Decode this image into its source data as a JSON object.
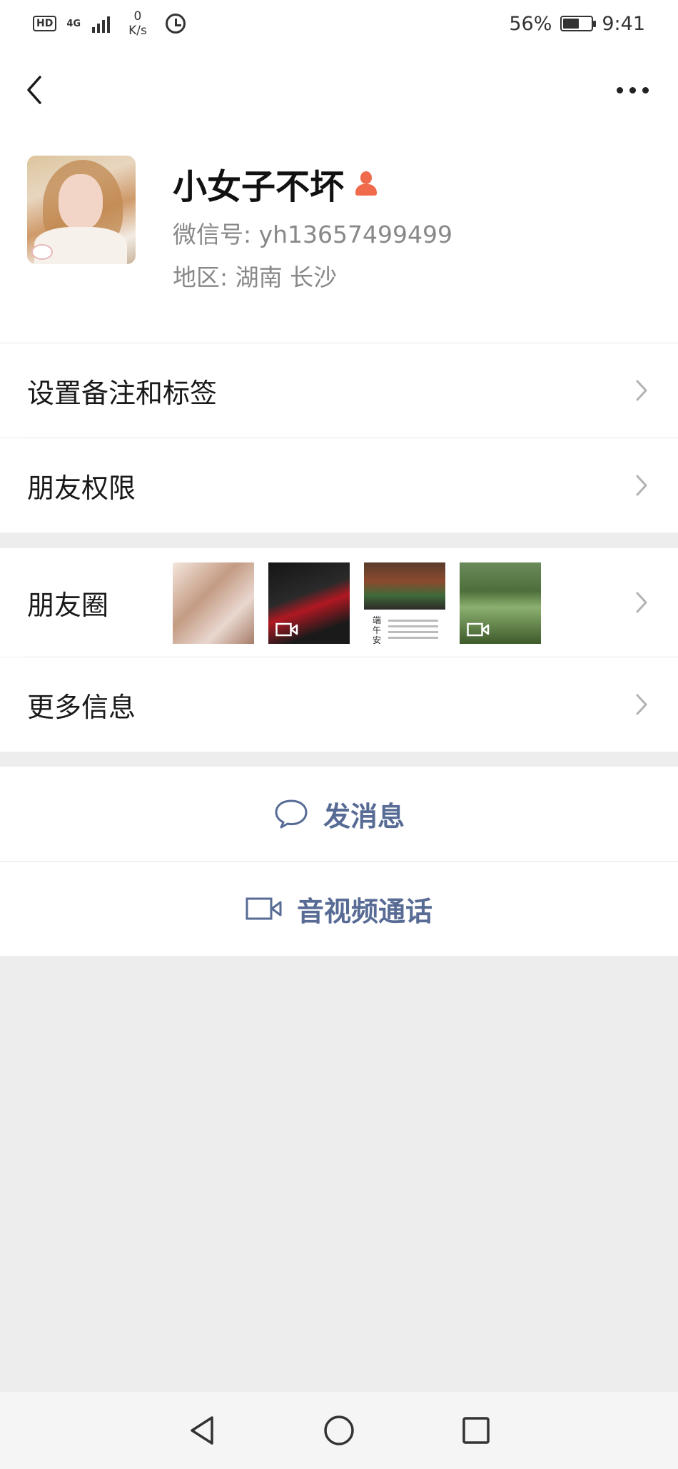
{
  "status_bar": {
    "hd": "HD",
    "network": "4G",
    "speed_value": "0",
    "speed_unit": "K/s",
    "battery": "56%",
    "time": "9:41"
  },
  "profile": {
    "name": "小女子不坏",
    "wechat_id": "微信号: yh13657499499",
    "region": "地区: 湖南  长沙"
  },
  "menu": {
    "remark_tags": "设置备注和标签",
    "friend_permissions": "朋友权限",
    "moments": "朋友圈",
    "more_info": "更多信息"
  },
  "moments_thumb3_text": "端午安",
  "actions": {
    "send_message": "发消息",
    "video_call": "音视频通话"
  },
  "colors": {
    "link_blue": "#576b95",
    "background": "#ededed",
    "gender_female": "#f06a4c"
  }
}
